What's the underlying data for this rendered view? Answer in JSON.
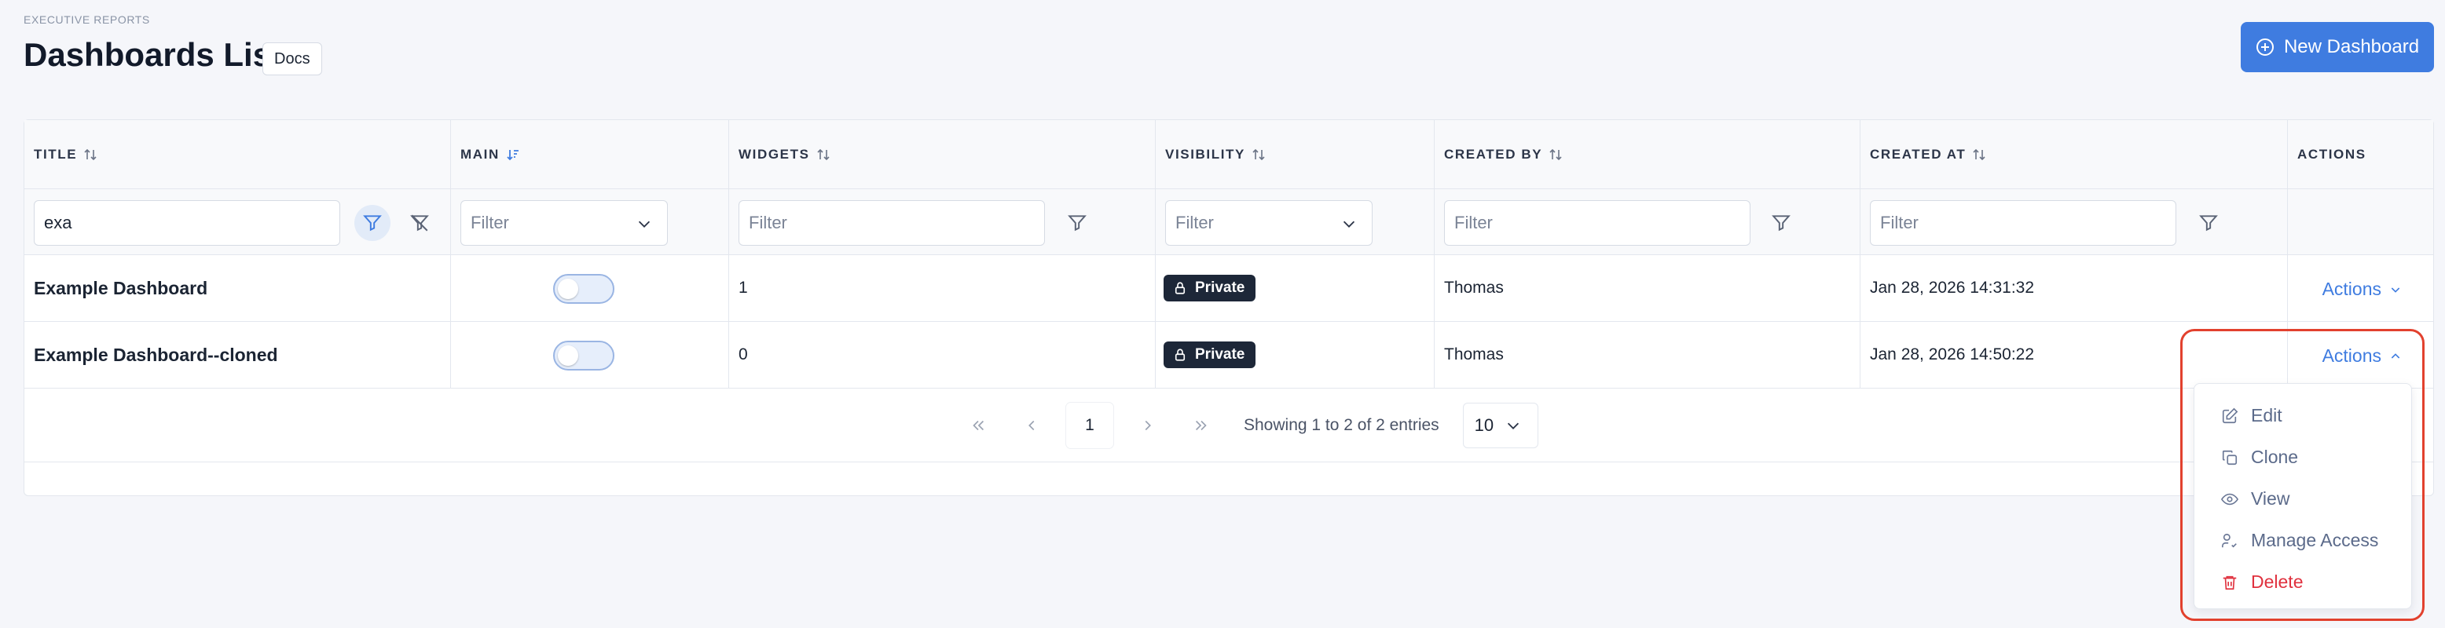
{
  "header": {
    "eyebrow": "EXECUTIVE REPORTS",
    "title": "Dashboards List",
    "docs_label": "Docs",
    "new_button_label": "New Dashboard"
  },
  "columns": {
    "title": "TITLE",
    "main": "MAIN",
    "widgets": "WIDGETS",
    "visibility": "VISIBILITY",
    "created_by": "CREATED BY",
    "created_at": "CREATED AT",
    "actions": "ACTIONS"
  },
  "filters": {
    "title_value": "exa",
    "placeholder": "Filter"
  },
  "rows": [
    {
      "title": "Example Dashboard",
      "main": false,
      "widgets": "1",
      "visibility": "Private",
      "created_by": "Thomas",
      "created_at": "Jan 28, 2026 14:31:32",
      "actions": "Actions"
    },
    {
      "title": "Example Dashboard--cloned",
      "main": false,
      "widgets": "0",
      "visibility": "Private",
      "created_by": "Thomas",
      "created_at": "Jan 28, 2026 14:50:22",
      "actions": "Actions"
    }
  ],
  "pagination": {
    "current_page": "1",
    "info": "Showing 1 to 2 of 2 entries",
    "page_size": "10"
  },
  "actions_menu": {
    "items": [
      "Edit",
      "Clone",
      "View",
      "Manage Access",
      "Delete"
    ]
  },
  "colors": {
    "accent": "#3f7ce0",
    "danger": "#e0313e",
    "highlight": "#e2412e",
    "badge_dark": "#1d2738"
  }
}
